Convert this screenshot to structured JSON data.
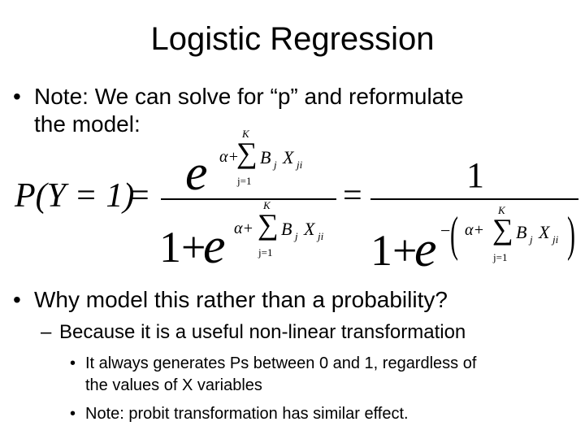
{
  "slide": {
    "title": "Logistic Regression",
    "bullets": [
      {
        "marker": "•",
        "text_line1": "Note:  We can solve for “p” and reformulate",
        "text_line2": "the model:"
      },
      {
        "marker": "•",
        "text": "Why model this rather than a probability?",
        "sub": {
          "marker": "–",
          "text": "Because it is a useful non-linear transformation",
          "sub": [
            {
              "marker": "•",
              "text_line1": "It always generates Ps between 0 and 1, regardless of",
              "text_line2": "the values of X variables"
            },
            {
              "marker": "•",
              "text_line1": "Note:  probit transformation has similar effect."
            }
          ]
        }
      }
    ],
    "formula": {
      "lhs": "P(Y = 1)",
      "eq": "=",
      "e": "e",
      "one": "1",
      "one_plus": "1+",
      "minus": "−",
      "alpha_plus": "α+",
      "sigma": "∑",
      "upper_limit": "K",
      "lower_limit": "j=1",
      "B": "B",
      "B_sub": "j",
      "X": "X",
      "X_sub": "ji",
      "lparen": "(",
      "rparen": ")"
    }
  }
}
